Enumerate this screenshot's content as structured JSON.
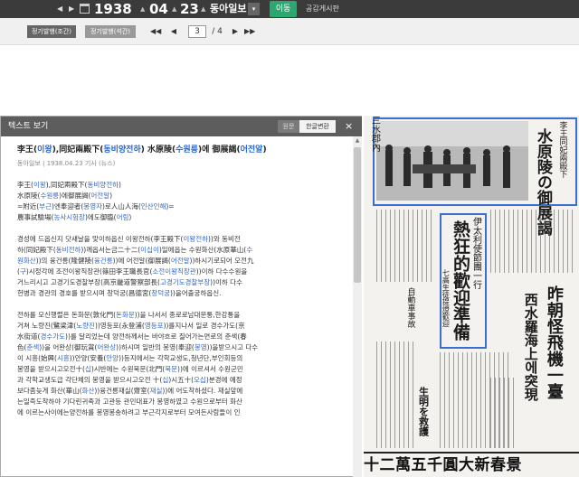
{
  "datebar": {
    "prev_arrow": "◀",
    "next_arrow": "▶",
    "year": "1938",
    "month": "04",
    "day": "23",
    "year_unit": "▲",
    "month_unit": "▲",
    "day_unit": "▲",
    "newspaper": "동아일보",
    "dropdown": "▾",
    "go_label": "이동",
    "board_label": "공감게시판"
  },
  "toolbar": {
    "edition_morning": "정기발행(조간)",
    "edition_evening": "정기발행(석간)",
    "first_btn": "◀◀",
    "prev_btn": "◀",
    "page_current": "3",
    "page_sep": "/ 4",
    "next_btn": "▶",
    "last_btn": "▶▶"
  },
  "panel": {
    "title": "텍스트 보기",
    "toggle_original": "원문",
    "toggle_korean": "한글변환",
    "close": "×",
    "headline_parts": [
      {
        "t": "李王(",
        "c": ""
      },
      {
        "t": "이왕",
        "c": "hl"
      },
      {
        "t": "),同妃兩殿下(",
        "c": ""
      },
      {
        "t": "동비양전하",
        "c": "hl"
      },
      {
        "t": ") 水原陵(",
        "c": ""
      },
      {
        "t": "수원릉",
        "c": "hl"
      },
      {
        "t": ")에 御展謁(",
        "c": ""
      },
      {
        "t": "어전알",
        "c": "hl"
      },
      {
        "t": ")",
        "c": ""
      }
    ],
    "meta": "동아일보 | 1938.04.23 기사 (뉴스)",
    "summary": [
      [
        {
          "t": "李王(",
          "c": ""
        },
        {
          "t": "이왕",
          "c": "hl"
        },
        {
          "t": "),同妃兩殿下(",
          "c": ""
        },
        {
          "t": "동비양전하",
          "c": "hl"
        },
        {
          "t": ")",
          "c": ""
        }
      ],
      [
        {
          "t": "水原陵(",
          "c": ""
        },
        {
          "t": "수원릉",
          "c": "hl"
        },
        {
          "t": ")에御展謁(",
          "c": ""
        },
        {
          "t": "어전알",
          "c": "hl"
        },
        {
          "t": ")",
          "c": ""
        }
      ],
      [
        {
          "t": "=附近(",
          "c": ""
        },
        {
          "t": "부근",
          "c": "hl"
        },
        {
          "t": ")엔奉迎者(",
          "c": ""
        },
        {
          "t": "봉영자",
          "c": "hl"
        },
        {
          "t": ")로人山人海(",
          "c": ""
        },
        {
          "t": "인산인해",
          "c": "hl"
        },
        {
          "t": ")=",
          "c": ""
        }
      ],
      [
        {
          "t": "農事試驗場(",
          "c": ""
        },
        {
          "t": "농사시험장",
          "c": "hl"
        },
        {
          "t": ")에도御臨(",
          "c": ""
        },
        {
          "t": "어림",
          "c": "hl"
        },
        {
          "t": ")",
          "c": ""
        }
      ]
    ],
    "para1": [
      [
        {
          "t": "  경성에 드옵신지 닷새날을 맞이하옵신 이왕전하(李王殿下(",
          "c": ""
        },
        {
          "t": "이왕전하",
          "c": "hl"
        },
        {
          "t": "))와 동비전",
          "c": ""
        }
      ],
      [
        {
          "t": "하(同妃殿下(",
          "c": ""
        },
        {
          "t": "동비전하",
          "c": "hl"
        },
        {
          "t": "))께옵서는금二十二(",
          "c": ""
        },
        {
          "t": "이십이",
          "c": "hl"
        },
        {
          "t": ")일에옵는 수원화산(水原華山(",
          "c": ""
        },
        {
          "t": "수",
          "c": "hl"
        }
      ],
      [
        {
          "t": "원화산",
          "c": "hl"
        },
        {
          "t": "))의 융건릉(隆健陵(",
          "c": ""
        },
        {
          "t": "융건릉",
          "c": "hl"
        },
        {
          "t": "))에 어전알(御展謁(",
          "c": ""
        },
        {
          "t": "어전알",
          "c": "hl"
        },
        {
          "t": "))하시기로되어 오전九",
          "c": ""
        }
      ],
      [
        {
          "t": "(",
          "c": ""
        },
        {
          "t": "구",
          "c": "hl"
        },
        {
          "t": ")시정각에 조전이왕직장관(篠田李王職長官(",
          "c": ""
        },
        {
          "t": "소전이왕직장관",
          "c": "hl"
        },
        {
          "t": "))이하 다수수원을",
          "c": ""
        }
      ],
      [
        {
          "t": "거느리시고 고경기도경찰부장(高京畿道警察部長(",
          "c": ""
        },
        {
          "t": "고경기도경찰부장",
          "c": "hl"
        },
        {
          "t": "))이하 다수",
          "c": ""
        }
      ],
      [
        {
          "t": "헌병과 경관의 경호를 받으시며 창덕궁(昌德宮(",
          "c": ""
        },
        {
          "t": "창덕궁",
          "c": "hl"
        },
        {
          "t": "))을어출궁하옵신.",
          "c": ""
        }
      ]
    ],
    "para2": [
      [
        {
          "t": "  전하를 모신행렬은 돈화문(敦化門(",
          "c": ""
        },
        {
          "t": "돈화문",
          "c": "hl"
        },
        {
          "t": "))을 나서서 종로로남대문통,한강통을",
          "c": ""
        }
      ],
      [
        {
          "t": "거쳐 노량진(鷺梁津(",
          "c": ""
        },
        {
          "t": "노량진",
          "c": "hl"
        },
        {
          "t": "))영등포(永登浦(",
          "c": ""
        },
        {
          "t": "영등포",
          "c": "hl"
        },
        {
          "t": "))를지나서 일로 경수가도(京",
          "c": ""
        }
      ],
      [
        {
          "t": "水街道(",
          "c": ""
        },
        {
          "t": "경수가도",
          "c": "hl"
        },
        {
          "t": "))를 달리었는데 양전하께서는 바야흐로 질어가는면로의 춘색(春",
          "c": ""
        }
      ],
      [
        {
          "t": "色(",
          "c": ""
        },
        {
          "t": "춘색",
          "c": "hl"
        },
        {
          "t": "))을 어완상(御玩賞(",
          "c": ""
        },
        {
          "t": "어완상",
          "c": "hl"
        },
        {
          "t": "))하시며 일반의 봉영(奉迎(",
          "c": ""
        },
        {
          "t": "봉영",
          "c": "hl"
        },
        {
          "t": "))을받으시고 다수",
          "c": ""
        }
      ],
      [
        {
          "t": "이 시흥(始興(",
          "c": ""
        },
        {
          "t": "시흥",
          "c": "hl"
        },
        {
          "t": "))안양(安養(",
          "c": ""
        },
        {
          "t": "안양",
          "c": "hl"
        },
        {
          "t": "))등지에서는 각학교생도,청년단,부인회등의",
          "c": ""
        }
      ],
      [
        {
          "t": "봉영을 받으시고오전十(",
          "c": ""
        },
        {
          "t": "십",
          "c": "hl"
        },
        {
          "t": ")시반에는 수원북문(北門(",
          "c": ""
        },
        {
          "t": "북문",
          "c": "hl"
        },
        {
          "t": "))에 이르셔서 수원군민",
          "c": ""
        }
      ],
      [
        {
          "t": "과 각학교생도급 각단체의 봉영을 받으시고오전 十(",
          "c": ""
        },
        {
          "t": "십",
          "c": "hl"
        },
        {
          "t": ")시五十(",
          "c": ""
        },
        {
          "t": "오십",
          "c": "hl"
        },
        {
          "t": ")분경에 예정",
          "c": ""
        }
      ],
      [
        {
          "t": "보다좀늦게 화산(華山(",
          "c": ""
        },
        {
          "t": "화산",
          "c": "hl"
        },
        {
          "t": "))융건릉재실(齋室(",
          "c": ""
        },
        {
          "t": "재실",
          "c": "hl"
        },
        {
          "t": "))에 어도착하셨다. 재실앞에",
          "c": ""
        }
      ],
      [
        {
          "t": "는일즉도착하야 기다린귀족과 고관등 관민대표가 봉영하였고 수원으로부터 화산",
          "c": ""
        }
      ],
      [
        {
          "t": "에 이르는사이에는양전하를 봉영봉송하려고 부근각지로부터 모여든사람들이 인",
          "c": ""
        }
      ]
    ]
  },
  "newspaper_image": {
    "headline_royal": "水原陵の御展謁",
    "headline_royal_sub": "李王同妃兩殿下",
    "headline_italy": "熱狂的歡迎準備",
    "headline_italy_sub": "伊太利使節團一行",
    "headline_italy_small": "七高生徒提燈歡迎",
    "headline_right": "昨朝怪飛機一臺",
    "headline_right2": "西水羅海上에突現",
    "headline_left_col": "三水郡內",
    "small_col_1": "自動車事故",
    "small_col_2": "生明を救護",
    "bottom_ad": "十二萬五千圓大新春景"
  }
}
